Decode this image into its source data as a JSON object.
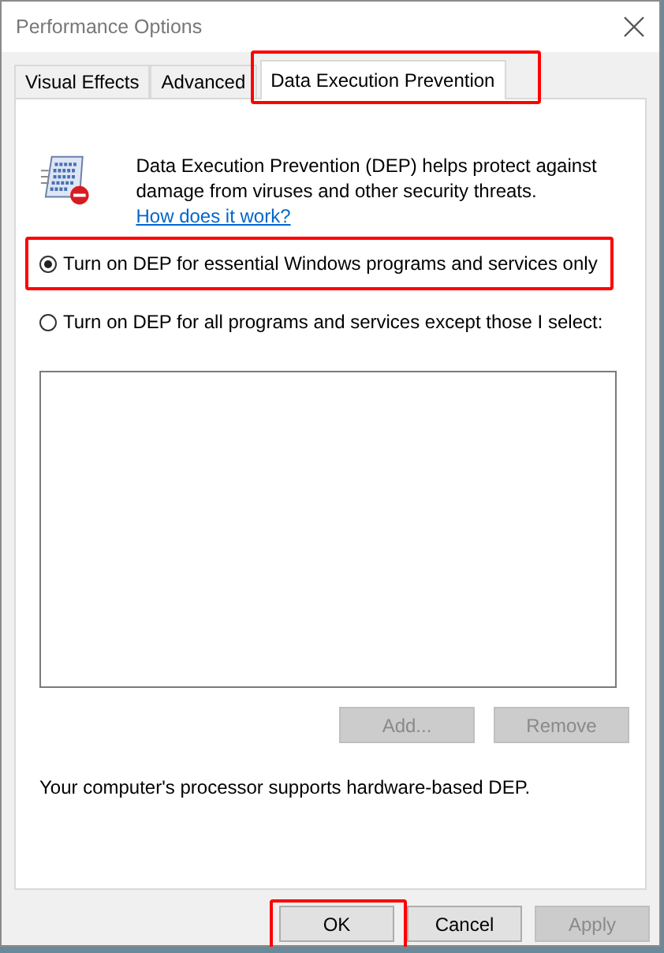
{
  "window": {
    "title": "Performance Options"
  },
  "tabs": [
    {
      "label": "Visual Effects",
      "selected": false,
      "highlighted": false
    },
    {
      "label": "Advanced",
      "selected": false,
      "highlighted": false
    },
    {
      "label": "Data Execution Prevention",
      "selected": true,
      "highlighted": true
    }
  ],
  "description": {
    "text": "Data Execution Prevention (DEP) helps protect against damage from viruses and other security threats.",
    "link": "How does it work?"
  },
  "options": [
    {
      "label": "Turn on DEP for essential Windows programs and services only",
      "selected": true,
      "highlighted": true
    },
    {
      "label": "Turn on DEP for all programs and services except those I select:",
      "selected": false,
      "highlighted": false
    }
  ],
  "list_buttons": [
    {
      "label": "Add...",
      "disabled": true
    },
    {
      "label": "Remove",
      "disabled": true
    }
  ],
  "status": "Your computer's processor supports hardware-based DEP.",
  "buttons": [
    {
      "label": "OK",
      "disabled": false,
      "highlighted": true
    },
    {
      "label": "Cancel",
      "disabled": false,
      "highlighted": false
    },
    {
      "label": "Apply",
      "disabled": true,
      "highlighted": false
    }
  ]
}
